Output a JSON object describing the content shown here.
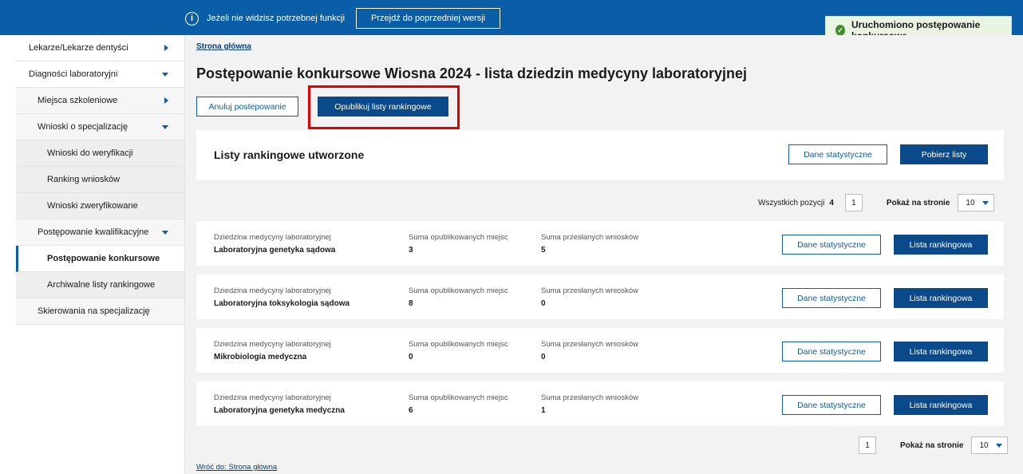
{
  "topbar": {
    "info_text": "Jeżeli nie widzisz potrzebnej funkcji",
    "prev_version_label": "Przejdź do poprzedniej wersji"
  },
  "toast": {
    "text": "Uruchomiono postępowanie konkursowe",
    "color": "#3f8f2f"
  },
  "sidebar": {
    "items": [
      {
        "label": "Lekarze/Lekarze dentyści",
        "caret": "right"
      },
      {
        "label": "Diagności laboratoryjni",
        "caret": "down"
      },
      {
        "label": "Miejsca szkoleniowe",
        "caret": "right"
      },
      {
        "label": "Wnioski o specjalizację",
        "caret": "down"
      },
      {
        "label": "Wnioski do weryfikacji"
      },
      {
        "label": "Ranking wniosków"
      },
      {
        "label": "Wnioski zweryfikowane"
      },
      {
        "label": "Postępowanie kwalifikacyjne",
        "caret": "down"
      },
      {
        "label": "Postępowanie konkursowe",
        "active": true
      },
      {
        "label": "Archiwalne listy rankingowe"
      },
      {
        "label": "Skierowania na specjalizację"
      }
    ]
  },
  "breadcrumb": "Strona główna",
  "page_title": "Postępowanie konkursowe Wiosna 2024 - lista dziedzin medycyny laboratoryjnej",
  "actions": {
    "cancel_label": "Anuluj postepowanie",
    "publish_label": "Opublikuj listy rankingowe"
  },
  "rank_card": {
    "title": "Listy rankingowe utworzone",
    "stats_label": "Dane statystyczne",
    "download_label": "Pobierz listy"
  },
  "pagination": {
    "total_label": "Wszystkich pozycji",
    "total_value": "4",
    "page": "1",
    "per_page_label": "Pokaż na stronie",
    "per_page_value": "10"
  },
  "columns": {
    "field": "Dziedzina medycyny laboratoryjnej",
    "published": "Suma opublikowanych miejsc",
    "submitted": "Suma przesłanych wniosków"
  },
  "rows": [
    {
      "field": "Laboratoryjna genetyka sądowa",
      "published": "3",
      "submitted": "5"
    },
    {
      "field": "Laboratoryjna toksykologia sądowa",
      "published": "8",
      "submitted": "0"
    },
    {
      "field": "Mikrobiologia medyczna",
      "published": "0",
      "submitted": "0"
    },
    {
      "field": "Laboratoryjna genetyka medyczna",
      "published": "6",
      "submitted": "1"
    }
  ],
  "row_actions": {
    "stats_label": "Dane statystyczne",
    "ranking_label": "Lista rankingowa"
  },
  "back_link": "Wróć do: Strona główna",
  "colors": {
    "primary": "#0a5ea8",
    "highlight": "#e00000"
  }
}
